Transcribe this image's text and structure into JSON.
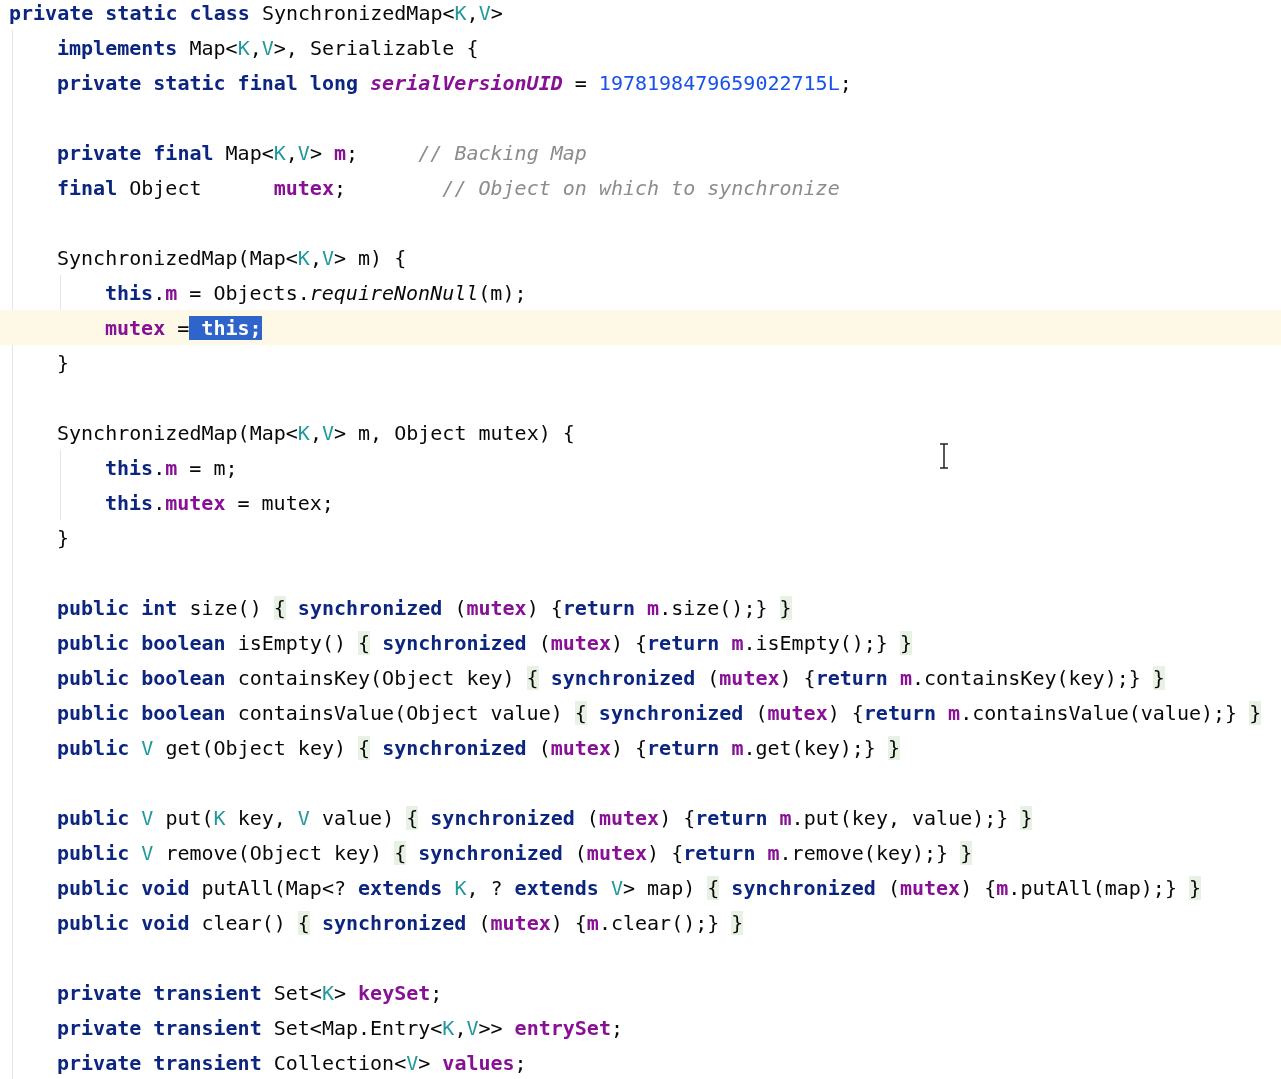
{
  "editor": {
    "lines": [
      {
        "kind": "code",
        "current": false,
        "tokens": [
          {
            "text": "private static class ",
            "kind": "kw"
          },
          {
            "text": "SynchronizedMap<",
            "kind": "plain"
          },
          {
            "text": "K",
            "kind": "tparam"
          },
          {
            "text": ",",
            "kind": "plain"
          },
          {
            "text": "V",
            "kind": "tparam"
          },
          {
            "text": ">",
            "kind": "plain"
          }
        ],
        "children": [
          {
            "kind": "code",
            "current": false,
            "tokens": [
              {
                "text": "implements ",
                "kind": "kw"
              },
              {
                "text": "Map<",
                "kind": "plain"
              },
              {
                "text": "K",
                "kind": "tparam"
              },
              {
                "text": ",",
                "kind": "plain"
              },
              {
                "text": "V",
                "kind": "tparam"
              },
              {
                "text": ">, Serializable {",
                "kind": "plain"
              }
            ]
          },
          {
            "kind": "code",
            "current": false,
            "tokens": [
              {
                "text": "private static final long ",
                "kind": "kw"
              },
              {
                "text": "serialVersionUID",
                "kind": "sfield"
              },
              {
                "text": " = ",
                "kind": "plain"
              },
              {
                "text": "1978198479659022715L",
                "kind": "num"
              },
              {
                "text": ";",
                "kind": "plain"
              }
            ]
          },
          {
            "kind": "blank"
          },
          {
            "kind": "code",
            "current": false,
            "tokens": [
              {
                "text": "private final ",
                "kind": "kw"
              },
              {
                "text": "Map<",
                "kind": "plain"
              },
              {
                "text": "K",
                "kind": "tparam"
              },
              {
                "text": ",",
                "kind": "plain"
              },
              {
                "text": "V",
                "kind": "tparam"
              },
              {
                "text": "> ",
                "kind": "plain"
              },
              {
                "text": "m",
                "kind": "field"
              },
              {
                "text": ";     ",
                "kind": "plain"
              },
              {
                "text": "// Backing Map",
                "kind": "comment"
              }
            ]
          },
          {
            "kind": "code",
            "current": false,
            "tokens": [
              {
                "text": "final ",
                "kind": "kw"
              },
              {
                "text": "Object      ",
                "kind": "plain"
              },
              {
                "text": "mutex",
                "kind": "field"
              },
              {
                "text": ";        ",
                "kind": "plain"
              },
              {
                "text": "// Object on which to synchronize",
                "kind": "comment"
              }
            ]
          },
          {
            "kind": "blank"
          },
          {
            "kind": "code",
            "current": false,
            "tokens": [
              {
                "text": "SynchronizedMap(Map<",
                "kind": "plain"
              },
              {
                "text": "K",
                "kind": "tparam"
              },
              {
                "text": ",",
                "kind": "plain"
              },
              {
                "text": "V",
                "kind": "tparam"
              },
              {
                "text": "> m) {",
                "kind": "plain"
              }
            ],
            "children": [
              {
                "kind": "code",
                "current": false,
                "tokens": [
                  {
                    "text": "this",
                    "kind": "kw"
                  },
                  {
                    "text": ".",
                    "kind": "plain"
                  },
                  {
                    "text": "m",
                    "kind": "field"
                  },
                  {
                    "text": " = Objects.",
                    "kind": "plain"
                  },
                  {
                    "text": "requireNonNull",
                    "kind": "italic"
                  },
                  {
                    "text": "(m);",
                    "kind": "plain"
                  }
                ]
              },
              {
                "kind": "code",
                "current": true,
                "tokens": [
                  {
                    "text": "mutex",
                    "kind": "field"
                  },
                  {
                    "text": " =",
                    "kind": "plain"
                  },
                  {
                    "text": " this;",
                    "kind": "selection"
                  }
                ]
              }
            ]
          },
          {
            "kind": "code",
            "current": false,
            "tokens": [
              {
                "text": "}",
                "kind": "plain"
              }
            ]
          },
          {
            "kind": "blank"
          },
          {
            "kind": "code",
            "current": false,
            "tokens": [
              {
                "text": "SynchronizedMap(Map<",
                "kind": "plain"
              },
              {
                "text": "K",
                "kind": "tparam"
              },
              {
                "text": ",",
                "kind": "plain"
              },
              {
                "text": "V",
                "kind": "tparam"
              },
              {
                "text": "> m, Object mutex) {",
                "kind": "plain"
              }
            ],
            "children": [
              {
                "kind": "code",
                "current": false,
                "tokens": [
                  {
                    "text": "this",
                    "kind": "kw"
                  },
                  {
                    "text": ".",
                    "kind": "plain"
                  },
                  {
                    "text": "m",
                    "kind": "field"
                  },
                  {
                    "text": " = m;",
                    "kind": "plain"
                  }
                ]
              },
              {
                "kind": "code",
                "current": false,
                "tokens": [
                  {
                    "text": "this",
                    "kind": "kw"
                  },
                  {
                    "text": ".",
                    "kind": "plain"
                  },
                  {
                    "text": "mutex",
                    "kind": "field"
                  },
                  {
                    "text": " = mutex;",
                    "kind": "plain"
                  }
                ]
              }
            ]
          },
          {
            "kind": "code",
            "current": false,
            "tokens": [
              {
                "text": "}",
                "kind": "plain"
              }
            ]
          },
          {
            "kind": "blank"
          },
          {
            "kind": "code",
            "current": false,
            "tokens": [
              {
                "text": "public int ",
                "kind": "kw"
              },
              {
                "text": "size() ",
                "kind": "plain"
              },
              {
                "text": "{",
                "kind": "brace"
              },
              {
                "text": " synchronized",
                "kind": "kw"
              },
              {
                "text": " (",
                "kind": "plain"
              },
              {
                "text": "mutex",
                "kind": "field"
              },
              {
                "text": ") {",
                "kind": "plain"
              },
              {
                "text": "return ",
                "kind": "kw"
              },
              {
                "text": "m",
                "kind": "field"
              },
              {
                "text": ".size();} ",
                "kind": "plain"
              },
              {
                "text": "}",
                "kind": "brace"
              }
            ]
          },
          {
            "kind": "code",
            "current": false,
            "tokens": [
              {
                "text": "public boolean ",
                "kind": "kw"
              },
              {
                "text": "isEmpty() ",
                "kind": "plain"
              },
              {
                "text": "{",
                "kind": "brace"
              },
              {
                "text": " synchronized",
                "kind": "kw"
              },
              {
                "text": " (",
                "kind": "plain"
              },
              {
                "text": "mutex",
                "kind": "field"
              },
              {
                "text": ") {",
                "kind": "plain"
              },
              {
                "text": "return ",
                "kind": "kw"
              },
              {
                "text": "m",
                "kind": "field"
              },
              {
                "text": ".isEmpty();} ",
                "kind": "plain"
              },
              {
                "text": "}",
                "kind": "brace"
              }
            ]
          },
          {
            "kind": "code",
            "current": false,
            "tokens": [
              {
                "text": "public boolean ",
                "kind": "kw"
              },
              {
                "text": "containsKey(Object key) ",
                "kind": "plain"
              },
              {
                "text": "{",
                "kind": "brace"
              },
              {
                "text": " synchronized",
                "kind": "kw"
              },
              {
                "text": " (",
                "kind": "plain"
              },
              {
                "text": "mutex",
                "kind": "field"
              },
              {
                "text": ") {",
                "kind": "plain"
              },
              {
                "text": "return ",
                "kind": "kw"
              },
              {
                "text": "m",
                "kind": "field"
              },
              {
                "text": ".containsKey(key);} ",
                "kind": "plain"
              },
              {
                "text": "}",
                "kind": "brace"
              }
            ]
          },
          {
            "kind": "code",
            "current": false,
            "tokens": [
              {
                "text": "public boolean ",
                "kind": "kw"
              },
              {
                "text": "containsValue(Object value) ",
                "kind": "plain"
              },
              {
                "text": "{",
                "kind": "brace"
              },
              {
                "text": " synchronized",
                "kind": "kw"
              },
              {
                "text": " (",
                "kind": "plain"
              },
              {
                "text": "mutex",
                "kind": "field"
              },
              {
                "text": ") {",
                "kind": "plain"
              },
              {
                "text": "return ",
                "kind": "kw"
              },
              {
                "text": "m",
                "kind": "field"
              },
              {
                "text": ".containsValue(value);} ",
                "kind": "plain"
              },
              {
                "text": "}",
                "kind": "brace"
              }
            ]
          },
          {
            "kind": "code",
            "current": false,
            "tokens": [
              {
                "text": "public ",
                "kind": "kw"
              },
              {
                "text": "V",
                "kind": "tparam"
              },
              {
                "text": " get(Object key) ",
                "kind": "plain"
              },
              {
                "text": "{",
                "kind": "brace"
              },
              {
                "text": " synchronized",
                "kind": "kw"
              },
              {
                "text": " (",
                "kind": "plain"
              },
              {
                "text": "mutex",
                "kind": "field"
              },
              {
                "text": ") {",
                "kind": "plain"
              },
              {
                "text": "return ",
                "kind": "kw"
              },
              {
                "text": "m",
                "kind": "field"
              },
              {
                "text": ".get(key);} ",
                "kind": "plain"
              },
              {
                "text": "}",
                "kind": "brace"
              }
            ]
          },
          {
            "kind": "blank"
          },
          {
            "kind": "code",
            "current": false,
            "tokens": [
              {
                "text": "public ",
                "kind": "kw"
              },
              {
                "text": "V",
                "kind": "tparam"
              },
              {
                "text": " put(",
                "kind": "plain"
              },
              {
                "text": "K",
                "kind": "tparam"
              },
              {
                "text": " key, ",
                "kind": "plain"
              },
              {
                "text": "V",
                "kind": "tparam"
              },
              {
                "text": " value) ",
                "kind": "plain"
              },
              {
                "text": "{",
                "kind": "brace"
              },
              {
                "text": " synchronized",
                "kind": "kw"
              },
              {
                "text": " (",
                "kind": "plain"
              },
              {
                "text": "mutex",
                "kind": "field"
              },
              {
                "text": ") {",
                "kind": "plain"
              },
              {
                "text": "return ",
                "kind": "kw"
              },
              {
                "text": "m",
                "kind": "field"
              },
              {
                "text": ".put(key, value);} ",
                "kind": "plain"
              },
              {
                "text": "}",
                "kind": "brace"
              }
            ]
          },
          {
            "kind": "code",
            "current": false,
            "tokens": [
              {
                "text": "public ",
                "kind": "kw"
              },
              {
                "text": "V",
                "kind": "tparam"
              },
              {
                "text": " remove(Object key) ",
                "kind": "plain"
              },
              {
                "text": "{",
                "kind": "brace"
              },
              {
                "text": " synchronized",
                "kind": "kw"
              },
              {
                "text": " (",
                "kind": "plain"
              },
              {
                "text": "mutex",
                "kind": "field"
              },
              {
                "text": ") {",
                "kind": "plain"
              },
              {
                "text": "return ",
                "kind": "kw"
              },
              {
                "text": "m",
                "kind": "field"
              },
              {
                "text": ".remove(key);} ",
                "kind": "plain"
              },
              {
                "text": "}",
                "kind": "brace"
              }
            ]
          },
          {
            "kind": "code",
            "current": false,
            "tokens": [
              {
                "text": "public void ",
                "kind": "kw"
              },
              {
                "text": "putAll(Map<? ",
                "kind": "plain"
              },
              {
                "text": "extends ",
                "kind": "kw"
              },
              {
                "text": "K",
                "kind": "tparam"
              },
              {
                "text": ", ? ",
                "kind": "plain"
              },
              {
                "text": "extends ",
                "kind": "kw"
              },
              {
                "text": "V",
                "kind": "tparam"
              },
              {
                "text": "> map) ",
                "kind": "plain"
              },
              {
                "text": "{",
                "kind": "brace"
              },
              {
                "text": " synchronized",
                "kind": "kw"
              },
              {
                "text": " (",
                "kind": "plain"
              },
              {
                "text": "mutex",
                "kind": "field"
              },
              {
                "text": ") {",
                "kind": "plain"
              },
              {
                "text": "m",
                "kind": "field"
              },
              {
                "text": ".putAll(map);} ",
                "kind": "plain"
              },
              {
                "text": "}",
                "kind": "brace"
              }
            ]
          },
          {
            "kind": "code",
            "current": false,
            "tokens": [
              {
                "text": "public void ",
                "kind": "kw"
              },
              {
                "text": "clear() ",
                "kind": "plain"
              },
              {
                "text": "{",
                "kind": "brace"
              },
              {
                "text": " synchronized",
                "kind": "kw"
              },
              {
                "text": " (",
                "kind": "plain"
              },
              {
                "text": "mutex",
                "kind": "field"
              },
              {
                "text": ") {",
                "kind": "plain"
              },
              {
                "text": "m",
                "kind": "field"
              },
              {
                "text": ".clear();} ",
                "kind": "plain"
              },
              {
                "text": "}",
                "kind": "brace"
              }
            ]
          },
          {
            "kind": "blank"
          },
          {
            "kind": "code",
            "current": false,
            "tokens": [
              {
                "text": "private transient ",
                "kind": "kw"
              },
              {
                "text": "Set<",
                "kind": "plain"
              },
              {
                "text": "K",
                "kind": "tparam"
              },
              {
                "text": "> ",
                "kind": "plain"
              },
              {
                "text": "keySet",
                "kind": "field"
              },
              {
                "text": ";",
                "kind": "plain"
              }
            ]
          },
          {
            "kind": "code",
            "current": false,
            "tokens": [
              {
                "text": "private transient ",
                "kind": "kw"
              },
              {
                "text": "Set<Map.Entry<",
                "kind": "plain"
              },
              {
                "text": "K",
                "kind": "tparam"
              },
              {
                "text": ",",
                "kind": "plain"
              },
              {
                "text": "V",
                "kind": "tparam"
              },
              {
                "text": ">> ",
                "kind": "plain"
              },
              {
                "text": "entrySet",
                "kind": "field"
              },
              {
                "text": ";",
                "kind": "plain"
              }
            ]
          },
          {
            "kind": "code",
            "current": false,
            "tokens": [
              {
                "text": "private transient ",
                "kind": "kw"
              },
              {
                "text": "Collection<",
                "kind": "plain"
              },
              {
                "text": "V",
                "kind": "tparam"
              },
              {
                "text": "> ",
                "kind": "plain"
              },
              {
                "text": "values",
                "kind": "field"
              },
              {
                "text": ";",
                "kind": "plain"
              }
            ]
          }
        ]
      }
    ]
  }
}
